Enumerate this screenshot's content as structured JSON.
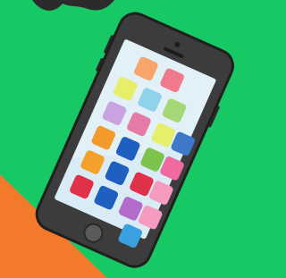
{
  "scene": {
    "kind": "smartphone illustration",
    "colors": {
      "background": "#17c964",
      "corner_shape": "#f47a2b",
      "top_blob": "#2b2b2b",
      "phone_body": "#3c3c3c",
      "phone_outline": "#1f1f1f",
      "screen": "#d9ecf6",
      "home_button": "#5a5a5a"
    },
    "app_icons": [
      "#f7a56b",
      "#f07a8c",
      "#e6ee6a",
      "#8fd3ea",
      "#a4d776",
      "#c9a3e0",
      "#e57aa8",
      "#e6ee6a",
      "#3f77c9",
      "#f39a2c",
      "#1e5fbf",
      "#7bc34d",
      "#f06aa0",
      "#f3a12b",
      "#1e5fbf",
      "#e0304a",
      "#f59bc0",
      "#e0304a",
      "#1e5fbf",
      "#b36cc9",
      "#f59bc0",
      "#3aa0e0",
      "#f6a33a"
    ]
  }
}
